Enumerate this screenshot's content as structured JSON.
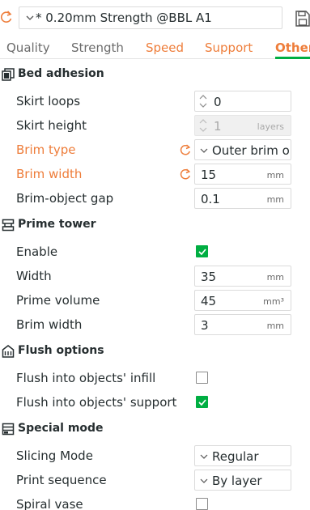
{
  "preset": {
    "name": "* 0.20mm Strength @BBL A1"
  },
  "tabs": [
    {
      "label": "Quality"
    },
    {
      "label": "Strength"
    },
    {
      "label": "Speed"
    },
    {
      "label": "Support"
    },
    {
      "label": "Others"
    }
  ],
  "colors": {
    "accent": "#00ae42",
    "modified": "#ee7d3a"
  },
  "sections": {
    "bed_adhesion": {
      "title": "Bed adhesion",
      "skirt_loops": {
        "label": "Skirt loops",
        "value": "0"
      },
      "skirt_height": {
        "label": "Skirt height",
        "value": "1",
        "unit": "layers"
      },
      "brim_type": {
        "label": "Brim type",
        "value": "Outer brim o..."
      },
      "brim_width": {
        "label": "Brim width",
        "value": "15",
        "unit": "mm"
      },
      "brim_object_gap": {
        "label": "Brim-object gap",
        "value": "0.1",
        "unit": "mm"
      }
    },
    "prime_tower": {
      "title": "Prime tower",
      "enable": {
        "label": "Enable",
        "checked": true
      },
      "width": {
        "label": "Width",
        "value": "35",
        "unit": "mm"
      },
      "prime_volume": {
        "label": "Prime volume",
        "value": "45",
        "unit": "mm³"
      },
      "brim_width": {
        "label": "Brim width",
        "value": "3",
        "unit": "mm"
      }
    },
    "flush_options": {
      "title": "Flush options",
      "flush_infill": {
        "label": "Flush into objects' infill",
        "checked": false
      },
      "flush_support": {
        "label": "Flush into objects' support",
        "checked": true
      }
    },
    "special_mode": {
      "title": "Special mode",
      "slicing_mode": {
        "label": "Slicing Mode",
        "value": "Regular"
      },
      "print_sequence": {
        "label": "Print sequence",
        "value": "By layer"
      },
      "spiral_vase": {
        "label": "Spiral vase",
        "checked": false
      }
    }
  }
}
